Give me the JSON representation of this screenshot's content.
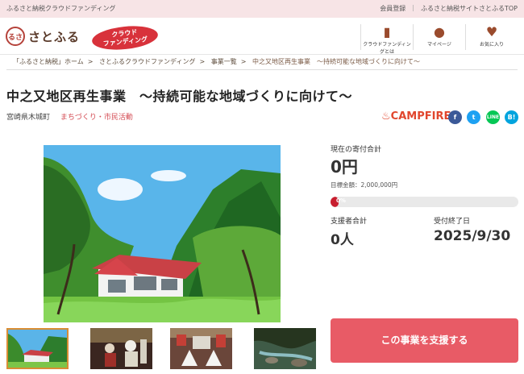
{
  "topbar": {
    "left": "ふるさと納税クラウドファンディング",
    "links": [
      "会員登録",
      "ふるさと納税サイトさとふるTOP"
    ]
  },
  "header": {
    "logo": "さとふる",
    "logo_mark": "るさ",
    "badge_line1": "クラウド",
    "badge_line2": "ファンディング",
    "nav": [
      {
        "label": "クラウドファンディングとは",
        "icon": "book-icon"
      },
      {
        "label": "マイページ",
        "icon": "user-icon"
      },
      {
        "label": "お気に入り",
        "icon": "heart-icon"
      }
    ]
  },
  "breadcrumb": [
    "「ふるさと納税」ホーム",
    "さとふるクラウドファンディング",
    "事業一覧",
    "中之又地区再生事業　～持続可能な地域づくりに向けて～"
  ],
  "project": {
    "title": "中之又地区再生事業　～持続可能な地域づくりに向けて～",
    "location": "宮崎県木城町",
    "category": "まちづくり・市民活動"
  },
  "share": {
    "campfire": "CAMPFIRE",
    "facebook": "f",
    "twitter": "t",
    "line": "LINE",
    "hatena": "B!"
  },
  "funding": {
    "current_label": "現在の寄付合計",
    "current_amount": "0円",
    "target_label": "目標金額：2,000,000円",
    "progress_percent": 0,
    "progress_text": "0%",
    "supporters_label": "支援者合計",
    "supporters": "0人",
    "deadline_label": "受付終了日",
    "deadline": "2025/9/30",
    "button": "この事業を支援する"
  },
  "colors": {
    "topbar": "#f7e4e6",
    "accent": "#d44d55",
    "button": "#e85b66",
    "progress": "#c81e2f"
  }
}
